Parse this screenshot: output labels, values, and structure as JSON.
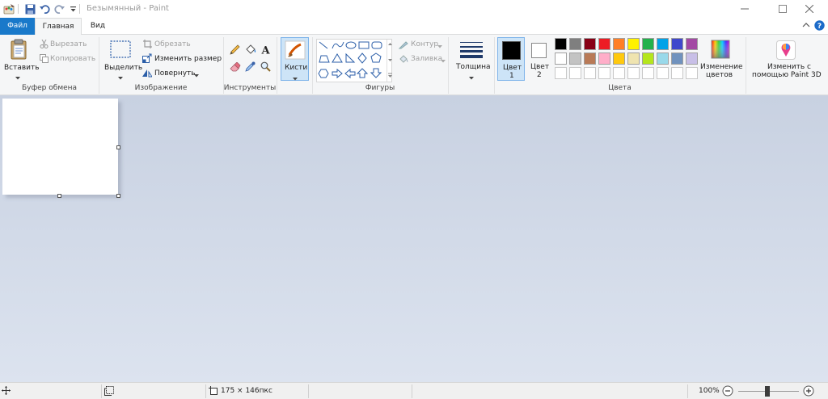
{
  "window": {
    "title": "Безымянный - Paint"
  },
  "tabs": [
    {
      "label": "Файл"
    },
    {
      "label": "Главная"
    },
    {
      "label": "Вид"
    }
  ],
  "clipboard": {
    "paste": "Вставить",
    "cut": "Вырезать",
    "copy": "Копировать",
    "group": "Буфер обмена"
  },
  "image": {
    "select": "Выделить",
    "crop": "Обрезать",
    "resize": "Изменить размер",
    "rotate": "Повернуть",
    "group": "Изображение"
  },
  "tools": {
    "group": "Инструменты"
  },
  "brushes": {
    "label": "Кисти"
  },
  "shapes": {
    "outline": "Контур",
    "fill": "Заливка",
    "group": "Фигуры"
  },
  "size": {
    "label": "Толщина"
  },
  "colors": {
    "color1_line1": "Цвет",
    "color1_line2": "1",
    "color2_line1": "Цвет",
    "color2_line2": "2",
    "edit_line1": "Изменение",
    "edit_line2": "цветов",
    "group": "Цвета",
    "color1_value": "#000000",
    "color2_value": "#ffffff",
    "palette_row1": [
      "#000000",
      "#7f7f7f",
      "#880015",
      "#ed1c24",
      "#ff7f27",
      "#fff200",
      "#22b14c",
      "#00a2e8",
      "#3f48cc",
      "#a349a4"
    ],
    "palette_row2": [
      "#ffffff",
      "#c3c3c3",
      "#b97a57",
      "#ffaec9",
      "#ffc90e",
      "#efe4b0",
      "#b5e61d",
      "#99d9ea",
      "#7092be",
      "#c8bfe7"
    ]
  },
  "paint3d": {
    "line1": "Изменить с",
    "line2": "помощью Paint 3D"
  },
  "statusbar": {
    "size": "175 × 146пкс",
    "zoom": "100%"
  }
}
